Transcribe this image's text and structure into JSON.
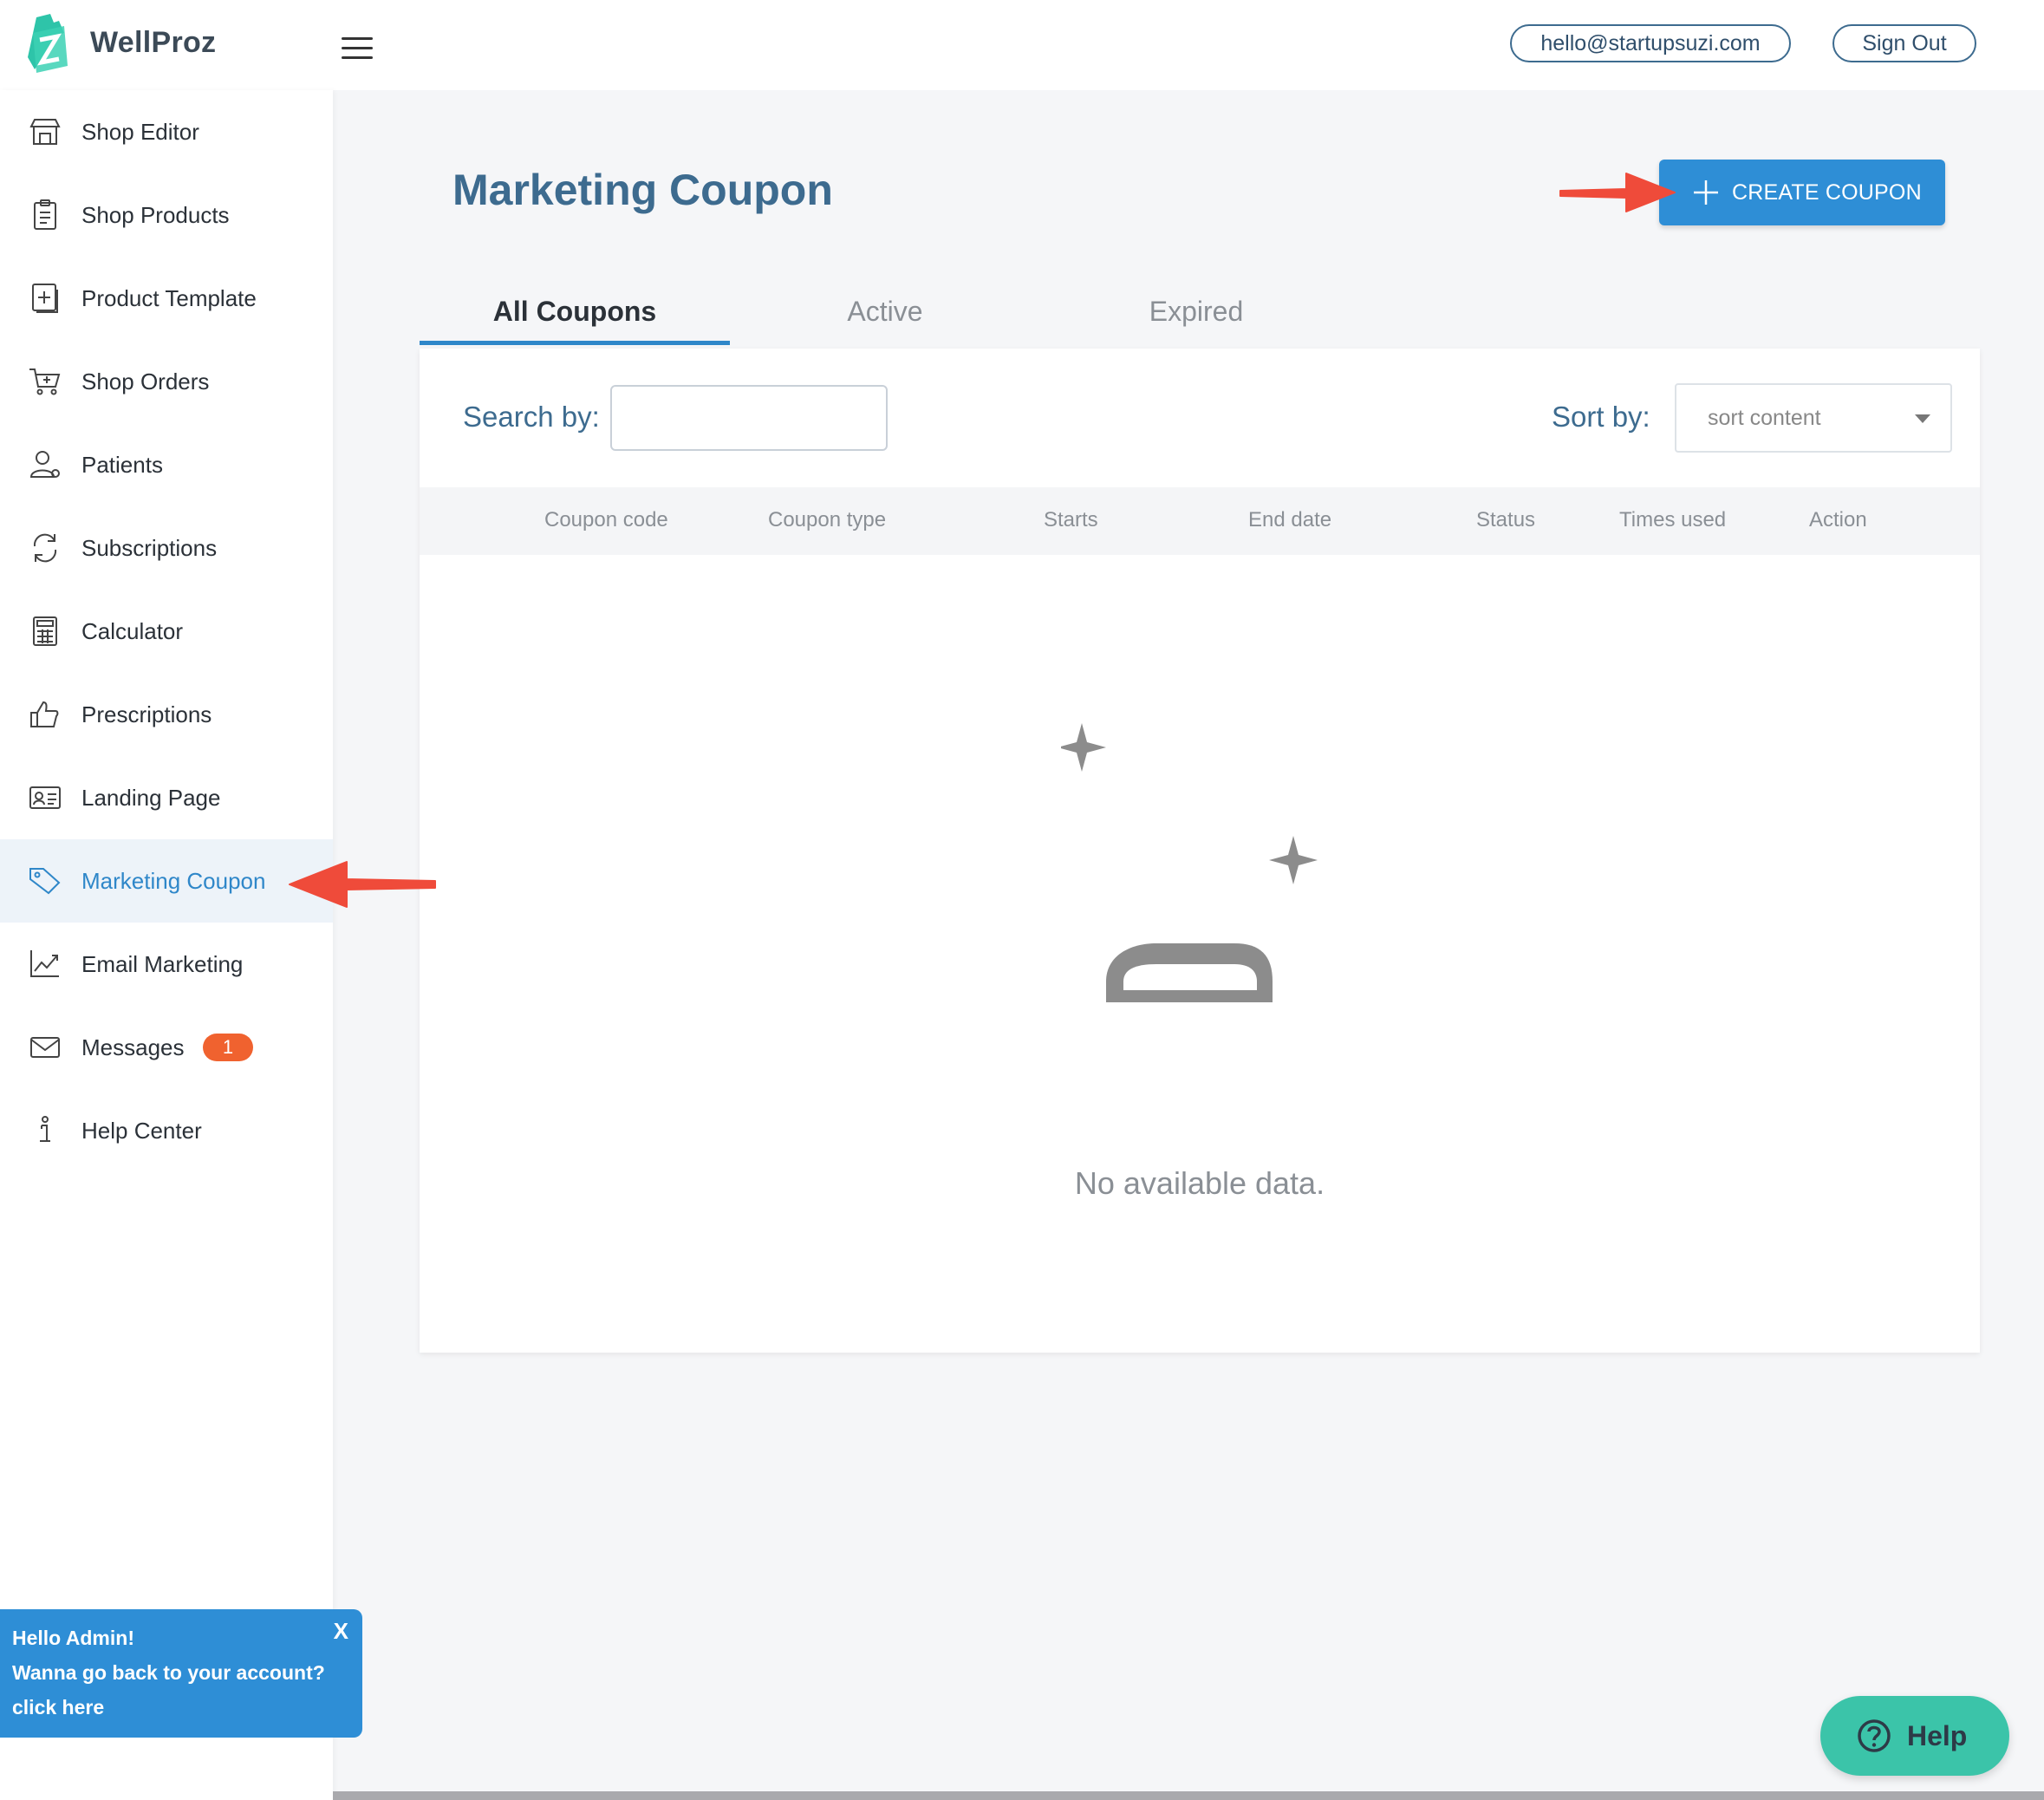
{
  "header": {
    "brand": "WellProz",
    "email": "hello@startupsuzi.com",
    "sign_out": "Sign Out"
  },
  "sidebar": {
    "items": [
      {
        "label": "Shop Editor",
        "icon": "storefront-icon"
      },
      {
        "label": "Shop Products",
        "icon": "clipboard-list-icon"
      },
      {
        "label": "Product Template",
        "icon": "plus-square-icon"
      },
      {
        "label": "Shop Orders",
        "icon": "cart-icon"
      },
      {
        "label": "Patients",
        "icon": "user-icon"
      },
      {
        "label": "Subscriptions",
        "icon": "refresh-icon"
      },
      {
        "label": "Calculator",
        "icon": "calculator-icon"
      },
      {
        "label": "Prescriptions",
        "icon": "thumbs-up-icon"
      },
      {
        "label": "Landing Page",
        "icon": "id-card-icon"
      },
      {
        "label": "Marketing Coupon",
        "icon": "tag-icon",
        "active": true
      },
      {
        "label": "Email Marketing",
        "icon": "chart-line-icon"
      },
      {
        "label": "Messages",
        "icon": "envelope-icon",
        "badge": "1"
      },
      {
        "label": "Help Center",
        "icon": "info-icon"
      }
    ]
  },
  "main": {
    "title": "Marketing Coupon",
    "create_button": "CREATE COUPON",
    "tabs": [
      "All Coupons",
      "Active",
      "Expired"
    ],
    "active_tab": 0,
    "search_label": "Search by:",
    "search_value": "",
    "sort_label": "Sort by:",
    "sort_value": "sort content",
    "columns": [
      "Coupon code",
      "Coupon type",
      "Starts",
      "End date",
      "Status",
      "Times used",
      "Action"
    ],
    "empty_text": "No available data."
  },
  "toast": {
    "line1": "Hello Admin!",
    "line2": "Wanna go back to your account?",
    "line3": "click here",
    "close": "X"
  },
  "help": {
    "label": "Help"
  },
  "colors": {
    "accent": "#2e8ed6",
    "title": "#3d6b8f",
    "badge": "#f0622f",
    "help": "#3bc4a9",
    "arrow": "#ef4b3a"
  }
}
